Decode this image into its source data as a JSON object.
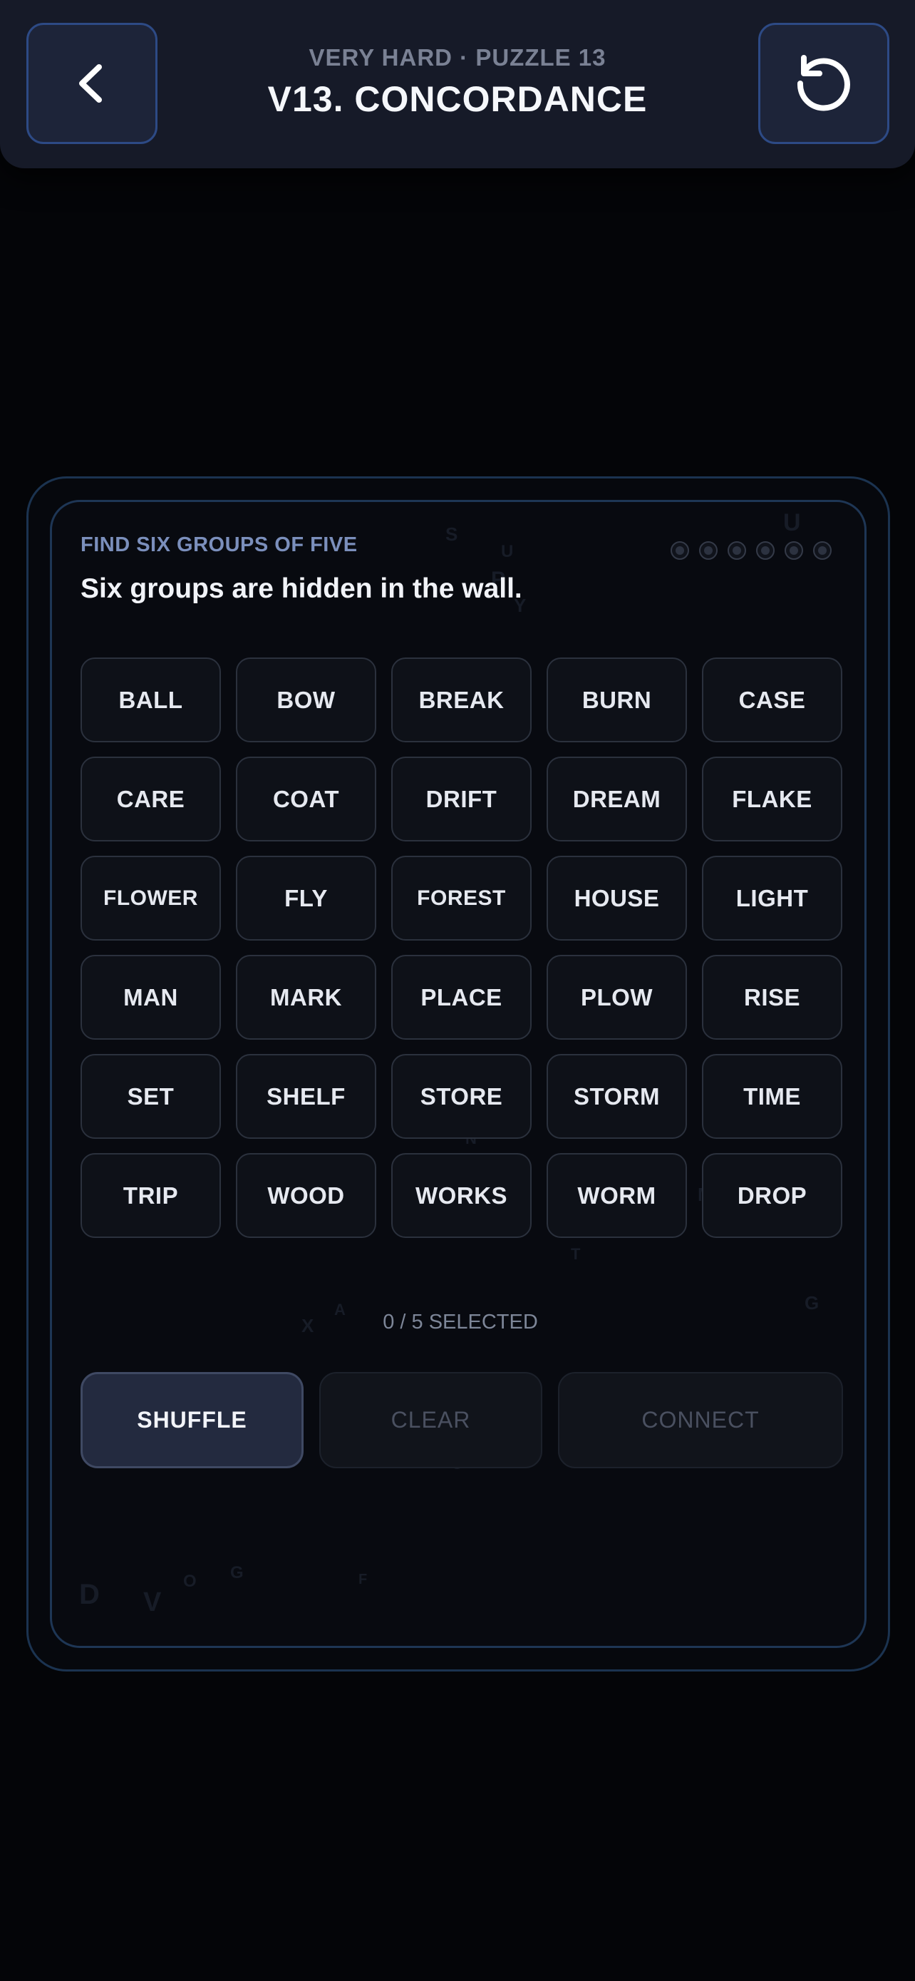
{
  "header": {
    "subtitle": "VERY HARD · PUZZLE 13",
    "title": "V13. CONCORDANCE",
    "back_icon": "chevron-left-icon",
    "reset_icon": "reset-icon"
  },
  "board": {
    "instruction_label": "FIND SIX GROUPS OF FIVE",
    "description": "Six groups are hidden in the wall.",
    "groups_total": 6,
    "groups_found": 0,
    "tiles": [
      "BALL",
      "BOW",
      "BREAK",
      "BURN",
      "CASE",
      "CARE",
      "COAT",
      "DRIFT",
      "DREAM",
      "FLAKE",
      "FLOWER",
      "FLY",
      "FOREST",
      "HOUSE",
      "LIGHT",
      "MAN",
      "MARK",
      "PLACE",
      "PLOW",
      "RISE",
      "SET",
      "SHELF",
      "STORE",
      "STORM",
      "TIME",
      "TRIP",
      "WOOD",
      "WORKS",
      "WORM",
      "DROP"
    ],
    "selected_text": "0 / 5 SELECTED"
  },
  "actions": {
    "shuffle": "SHUFFLE",
    "clear": "CLEAR",
    "connect": "CONNECT"
  },
  "colors": {
    "accent_border": "#2d4a85",
    "header_bg": "#161a28",
    "tile_bg": "#0e1118",
    "shuffle_bg": "#232a3f"
  }
}
